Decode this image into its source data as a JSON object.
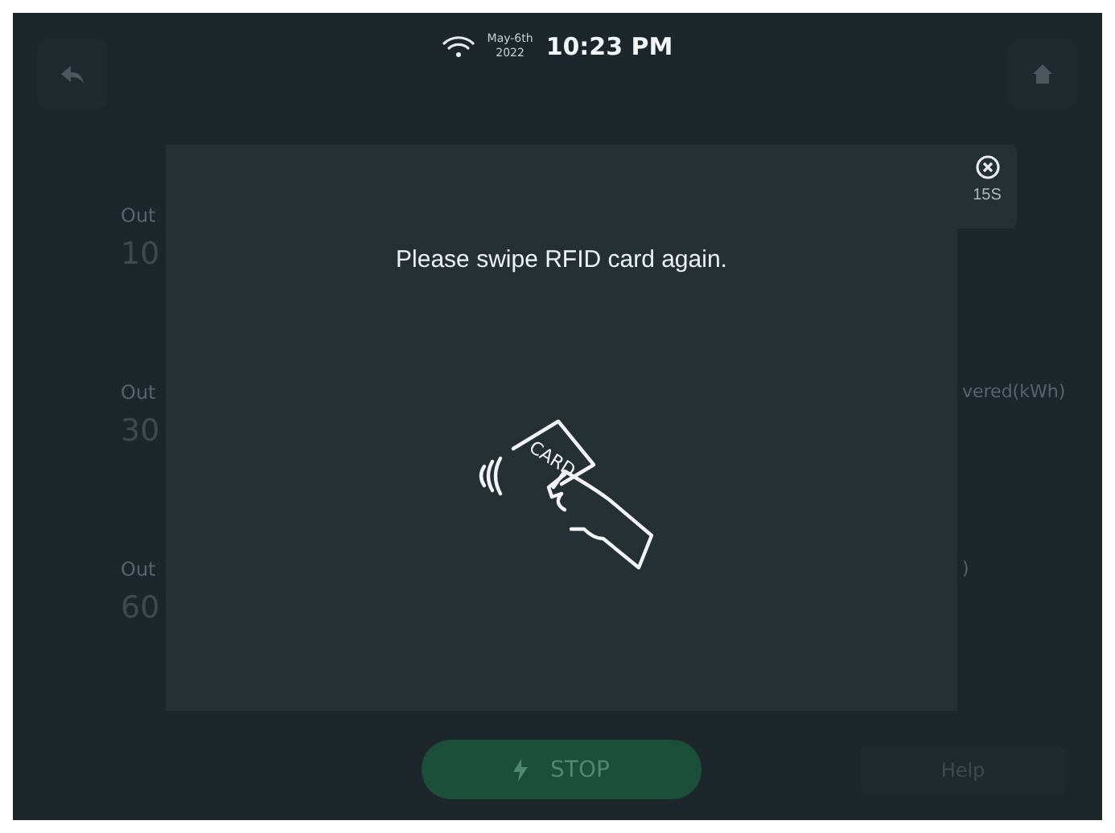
{
  "status_bar": {
    "date_line_1": "May-6th",
    "date_line_2": "2022",
    "time": "10:23 PM"
  },
  "background": {
    "left_rows": [
      {
        "label": "Out",
        "value": "10"
      },
      {
        "label": "Out",
        "value": "30"
      },
      {
        "label": "Out",
        "value": "60"
      }
    ],
    "right_rows": [
      {
        "label": "vered(kWh)"
      },
      {
        "label": ")"
      }
    ]
  },
  "dialog": {
    "message": "Please swipe RFID card again.",
    "card_label": "CARD",
    "countdown": "15S"
  },
  "buttons": [
    {
      "kind": "primary",
      "label": "STOP"
    },
    {
      "kind": "secondary",
      "label": "Help"
    }
  ]
}
